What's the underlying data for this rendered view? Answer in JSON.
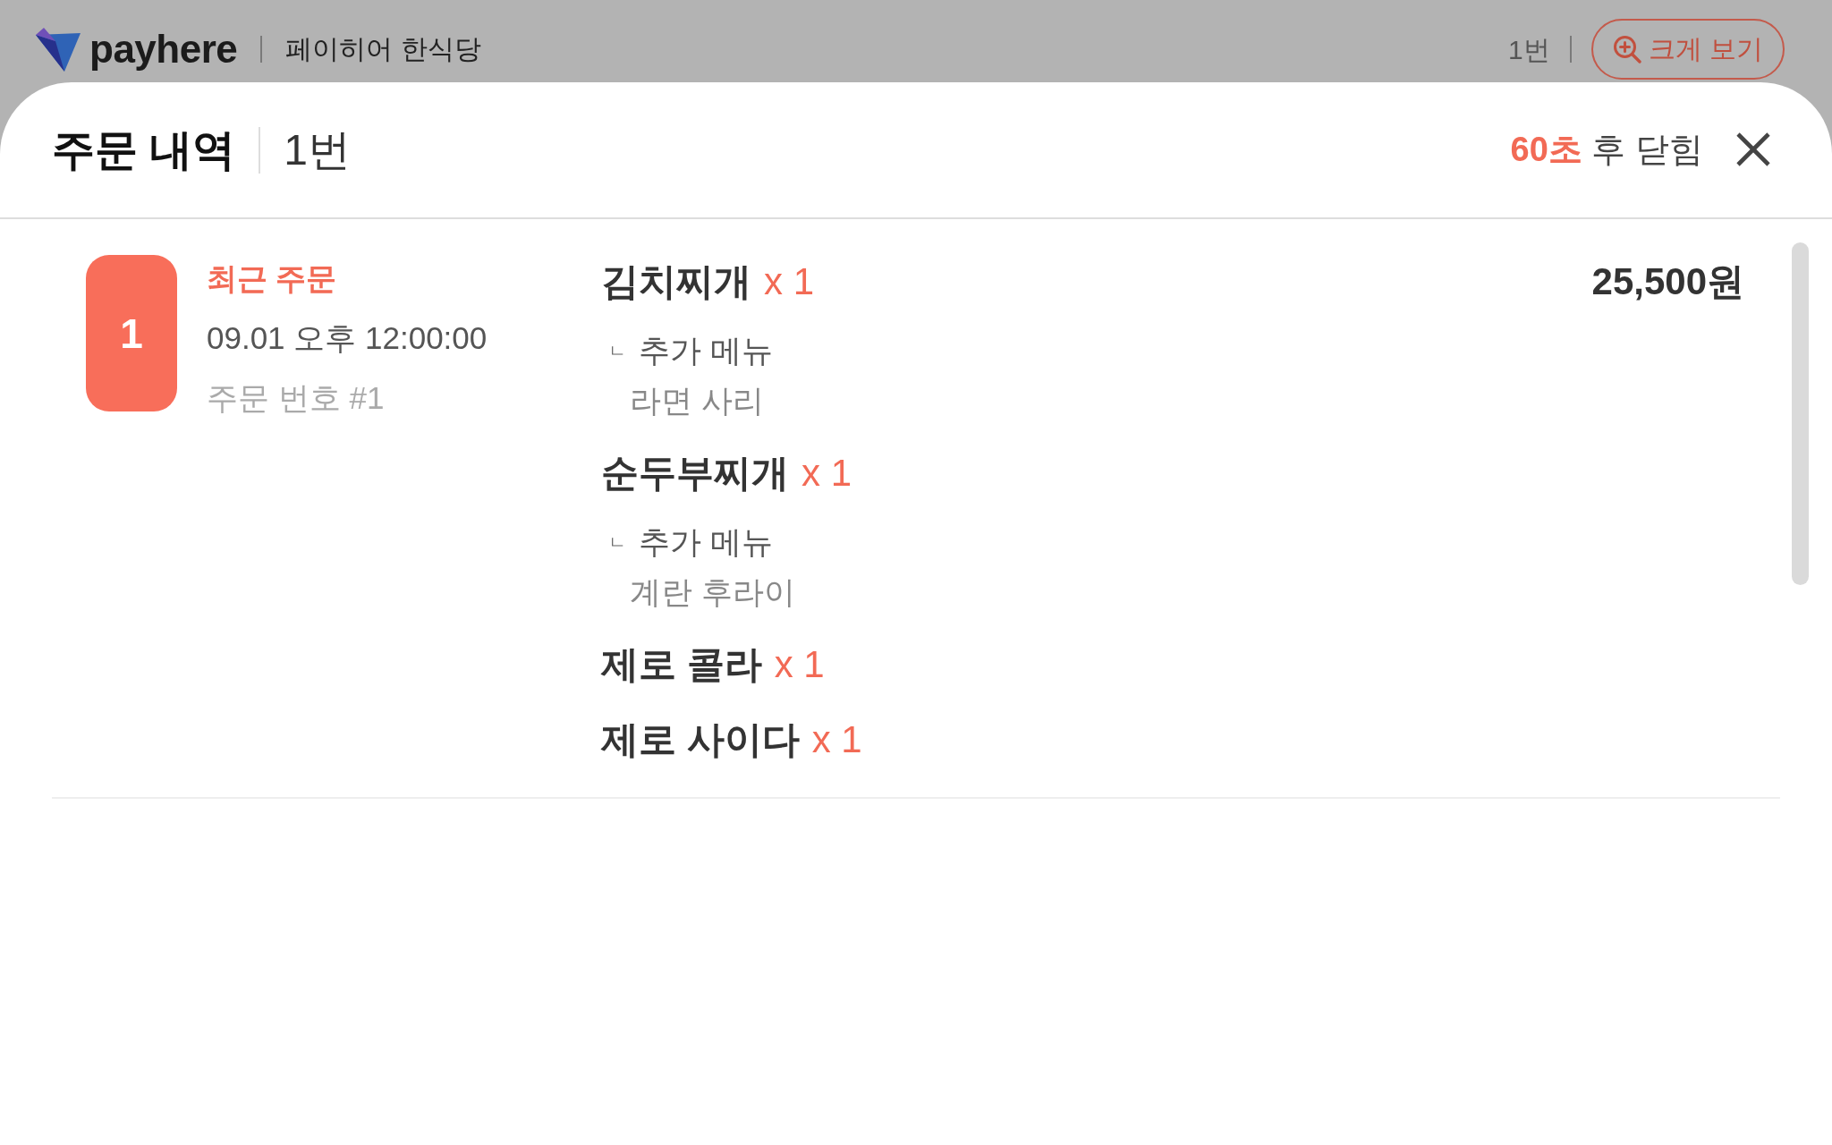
{
  "top_bar": {
    "brand": "payhere",
    "store_name": "페이히어 한식당",
    "table": "1번",
    "zoom_button": "크게 보기"
  },
  "sheet": {
    "title": "주문 내역",
    "table": "1번",
    "countdown": "60초",
    "countdown_suffix": "후 닫힘"
  },
  "orders": [
    {
      "number": "1",
      "status": "최근 주문",
      "time": "09.01 오후 12:00:00",
      "order_no": "주문 번호 #1",
      "total": "25,500원",
      "items": [
        {
          "name": "김치찌개",
          "qty": "x 1",
          "options": [
            {
              "marker": "ㄴ",
              "group": "추가 메뉴",
              "choice": "라면 사리"
            }
          ]
        },
        {
          "name": "순두부찌개",
          "qty": "x 1",
          "options": [
            {
              "marker": "ㄴ",
              "group": "추가 메뉴",
              "choice": "계란 후라이"
            }
          ]
        },
        {
          "name": "제로 콜라",
          "qty": "x 1"
        },
        {
          "name": "제로 사이다",
          "qty": "x 1"
        }
      ]
    }
  ]
}
